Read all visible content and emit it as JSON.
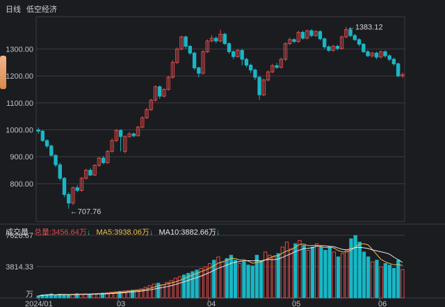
{
  "header": {
    "period": "日线",
    "stock_name": "低空经济"
  },
  "colors": {
    "up": "#e04b4b",
    "down": "#19b6c5",
    "ma5": "#f0c04a",
    "ma10": "#e8e8ee",
    "grid": "#3a3c44"
  },
  "price_axis": {
    "ticks": [
      "1300.00",
      "1200.00",
      "1100.00",
      "1000.00",
      "900.00",
      "800.00"
    ],
    "range": [
      660,
      1420
    ]
  },
  "annotations": {
    "high": "←1383.12",
    "low": "←707.76"
  },
  "volume_panel": {
    "title": "成交量",
    "total_label": "总量:3456.64万",
    "ma5_label": "MA5:3938.06万",
    "ma10_label": "MA10:3882.66万",
    "arrow": "↓",
    "ticks": [
      "7628.67",
      "3814.33"
    ],
    "unit": "万"
  },
  "x_axis": {
    "labels": [
      "2024/01",
      "03",
      "04",
      "05",
      "06"
    ]
  },
  "chart_data": {
    "type": "candlestick",
    "price_high_marker": 1383.12,
    "price_low_marker": 707.76,
    "candles": [
      {
        "o": 1000,
        "c": 995,
        "h": 1008,
        "l": 985
      },
      {
        "o": 995,
        "c": 960,
        "h": 1000,
        "l": 955
      },
      {
        "o": 960,
        "c": 940,
        "h": 965,
        "l": 932
      },
      {
        "o": 940,
        "c": 905,
        "h": 945,
        "l": 900
      },
      {
        "o": 905,
        "c": 870,
        "h": 910,
        "l": 862
      },
      {
        "o": 870,
        "c": 820,
        "h": 878,
        "l": 812
      },
      {
        "o": 820,
        "c": 760,
        "h": 825,
        "l": 750
      },
      {
        "o": 760,
        "c": 728,
        "h": 768,
        "l": 707
      },
      {
        "o": 728,
        "c": 785,
        "h": 790,
        "l": 720
      },
      {
        "o": 785,
        "c": 775,
        "h": 795,
        "l": 768
      },
      {
        "o": 775,
        "c": 820,
        "h": 825,
        "l": 770
      },
      {
        "o": 820,
        "c": 850,
        "h": 855,
        "l": 815
      },
      {
        "o": 850,
        "c": 832,
        "h": 858,
        "l": 828
      },
      {
        "o": 832,
        "c": 868,
        "h": 872,
        "l": 828
      },
      {
        "o": 868,
        "c": 895,
        "h": 900,
        "l": 862
      },
      {
        "o": 895,
        "c": 878,
        "h": 903,
        "l": 872
      },
      {
        "o": 878,
        "c": 920,
        "h": 925,
        "l": 874
      },
      {
        "o": 920,
        "c": 960,
        "h": 968,
        "l": 915
      },
      {
        "o": 960,
        "c": 998,
        "h": 1003,
        "l": 955
      },
      {
        "o": 998,
        "c": 975,
        "h": 1002,
        "l": 920
      },
      {
        "o": 920,
        "c": 975,
        "h": 980,
        "l": 912
      },
      {
        "o": 975,
        "c": 985,
        "h": 992,
        "l": 970
      },
      {
        "o": 985,
        "c": 978,
        "h": 990,
        "l": 972
      },
      {
        "o": 978,
        "c": 1010,
        "h": 1015,
        "l": 975
      },
      {
        "o": 1010,
        "c": 1045,
        "h": 1050,
        "l": 1005
      },
      {
        "o": 1045,
        "c": 1075,
        "h": 1082,
        "l": 1040
      },
      {
        "o": 1075,
        "c": 1110,
        "h": 1115,
        "l": 1070
      },
      {
        "o": 1110,
        "c": 1160,
        "h": 1165,
        "l": 1105
      },
      {
        "o": 1160,
        "c": 1125,
        "h": 1165,
        "l": 1115
      },
      {
        "o": 1125,
        "c": 1150,
        "h": 1155,
        "l": 1120
      },
      {
        "o": 1150,
        "c": 1195,
        "h": 1200,
        "l": 1145
      },
      {
        "o": 1195,
        "c": 1250,
        "h": 1258,
        "l": 1190
      },
      {
        "o": 1250,
        "c": 1300,
        "h": 1305,
        "l": 1245
      },
      {
        "o": 1300,
        "c": 1345,
        "h": 1350,
        "l": 1295
      },
      {
        "o": 1345,
        "c": 1310,
        "h": 1350,
        "l": 1300
      },
      {
        "o": 1310,
        "c": 1285,
        "h": 1315,
        "l": 1278
      },
      {
        "o": 1285,
        "c": 1230,
        "h": 1290,
        "l": 1222
      },
      {
        "o": 1230,
        "c": 1210,
        "h": 1235,
        "l": 1195
      },
      {
        "o": 1210,
        "c": 1290,
        "h": 1296,
        "l": 1205
      },
      {
        "o": 1290,
        "c": 1330,
        "h": 1336,
        "l": 1285
      },
      {
        "o": 1330,
        "c": 1340,
        "h": 1352,
        "l": 1325
      },
      {
        "o": 1340,
        "c": 1330,
        "h": 1346,
        "l": 1322
      },
      {
        "o": 1330,
        "c": 1355,
        "h": 1372,
        "l": 1325
      },
      {
        "o": 1355,
        "c": 1320,
        "h": 1360,
        "l": 1315
      },
      {
        "o": 1320,
        "c": 1290,
        "h": 1325,
        "l": 1282
      },
      {
        "o": 1290,
        "c": 1272,
        "h": 1296,
        "l": 1262
      },
      {
        "o": 1272,
        "c": 1295,
        "h": 1300,
        "l": 1268
      },
      {
        "o": 1295,
        "c": 1262,
        "h": 1300,
        "l": 1240
      },
      {
        "o": 1262,
        "c": 1240,
        "h": 1268,
        "l": 1232
      },
      {
        "o": 1240,
        "c": 1222,
        "h": 1246,
        "l": 1210
      },
      {
        "o": 1222,
        "c": 1195,
        "h": 1228,
        "l": 1185
      },
      {
        "o": 1195,
        "c": 1130,
        "h": 1200,
        "l": 1112
      },
      {
        "o": 1130,
        "c": 1185,
        "h": 1190,
        "l": 1125
      },
      {
        "o": 1185,
        "c": 1215,
        "h": 1220,
        "l": 1180
      },
      {
        "o": 1215,
        "c": 1238,
        "h": 1245,
        "l": 1210
      },
      {
        "o": 1238,
        "c": 1232,
        "h": 1248,
        "l": 1226
      },
      {
        "o": 1232,
        "c": 1262,
        "h": 1268,
        "l": 1228
      },
      {
        "o": 1262,
        "c": 1320,
        "h": 1325,
        "l": 1255
      },
      {
        "o": 1320,
        "c": 1335,
        "h": 1342,
        "l": 1315
      },
      {
        "o": 1335,
        "c": 1328,
        "h": 1340,
        "l": 1322
      },
      {
        "o": 1328,
        "c": 1362,
        "h": 1368,
        "l": 1323
      },
      {
        "o": 1362,
        "c": 1340,
        "h": 1368,
        "l": 1335
      },
      {
        "o": 1340,
        "c": 1368,
        "h": 1372,
        "l": 1336
      },
      {
        "o": 1368,
        "c": 1350,
        "h": 1374,
        "l": 1344
      },
      {
        "o": 1350,
        "c": 1365,
        "h": 1370,
        "l": 1345
      },
      {
        "o": 1365,
        "c": 1338,
        "h": 1370,
        "l": 1332
      },
      {
        "o": 1338,
        "c": 1308,
        "h": 1342,
        "l": 1300
      },
      {
        "o": 1308,
        "c": 1295,
        "h": 1314,
        "l": 1290
      },
      {
        "o": 1295,
        "c": 1310,
        "h": 1316,
        "l": 1290
      },
      {
        "o": 1310,
        "c": 1302,
        "h": 1316,
        "l": 1295
      },
      {
        "o": 1302,
        "c": 1345,
        "h": 1350,
        "l": 1298
      },
      {
        "o": 1345,
        "c": 1372,
        "h": 1383,
        "l": 1340
      },
      {
        "o": 1372,
        "c": 1350,
        "h": 1378,
        "l": 1344
      },
      {
        "o": 1350,
        "c": 1335,
        "h": 1356,
        "l": 1330
      },
      {
        "o": 1335,
        "c": 1318,
        "h": 1340,
        "l": 1310
      },
      {
        "o": 1318,
        "c": 1290,
        "h": 1322,
        "l": 1285
      },
      {
        "o": 1290,
        "c": 1275,
        "h": 1296,
        "l": 1270
      },
      {
        "o": 1275,
        "c": 1285,
        "h": 1290,
        "l": 1268
      },
      {
        "o": 1285,
        "c": 1270,
        "h": 1290,
        "l": 1262
      },
      {
        "o": 1270,
        "c": 1290,
        "h": 1294,
        "l": 1266
      },
      {
        "o": 1290,
        "c": 1275,
        "h": 1295,
        "l": 1268
      },
      {
        "o": 1275,
        "c": 1262,
        "h": 1280,
        "l": 1255
      },
      {
        "o": 1262,
        "c": 1245,
        "h": 1268,
        "l": 1238
      },
      {
        "o": 1245,
        "c": 1200,
        "h": 1250,
        "l": 1195
      },
      {
        "o": 1200,
        "c": 1205,
        "h": 1212,
        "l": 1192
      }
    ],
    "volume": [
      250,
      380,
      420,
      500,
      350,
      460,
      420,
      380,
      450,
      520,
      480,
      500,
      460,
      520,
      560,
      600,
      640,
      700,
      760,
      800,
      850,
      900,
      950,
      1000,
      1100,
      1300,
      1500,
      1700,
      1800,
      1600,
      1900,
      2100,
      2400,
      2600,
      2800,
      3000,
      3200,
      3400,
      3600,
      3800,
      4200,
      4600,
      5000,
      4400,
      4800,
      5200,
      4600,
      4200,
      4400,
      4000,
      3900,
      5200,
      4500,
      5600,
      5200,
      5000,
      5400,
      6200,
      6800,
      6000,
      6600,
      7000,
      6400,
      5800,
      6200,
      6600,
      6200,
      5800,
      6200,
      5600,
      5000,
      5400,
      5800,
      7200,
      7600,
      6800,
      5600,
      5000,
      4400,
      4600,
      3800,
      4200,
      4000,
      3600,
      4600,
      3456
    ]
  }
}
